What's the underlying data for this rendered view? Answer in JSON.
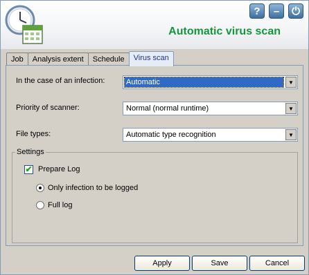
{
  "window": {
    "title": "Automatic virus scan"
  },
  "header_buttons": {
    "help": "?",
    "minimize": "–",
    "power": "⏻"
  },
  "tabs": [
    {
      "label": "Job",
      "active": false
    },
    {
      "label": "Analysis extent",
      "active": false
    },
    {
      "label": "Schedule",
      "active": false
    },
    {
      "label": "Virus scan",
      "active": true
    }
  ],
  "form": {
    "infection": {
      "label": "In the case of an infection:",
      "value": "Automatic"
    },
    "priority": {
      "label": "Priority of scanner:",
      "value": "Normal (normal runtime)"
    },
    "file_types": {
      "label": "File types:",
      "value": "Automatic type recognition"
    }
  },
  "settings": {
    "legend": "Settings",
    "prepare_log": {
      "label": "Prepare Log",
      "checked": true
    },
    "options": [
      {
        "label": "Only infection to be logged",
        "selected": true
      },
      {
        "label": "Full log",
        "selected": false
      }
    ]
  },
  "footer": {
    "apply": "Apply",
    "save": "Save",
    "cancel": "Cancel"
  },
  "colors": {
    "title": "#16963a",
    "active_tab_text": "#1f2f96",
    "selection": "#316ac5"
  }
}
